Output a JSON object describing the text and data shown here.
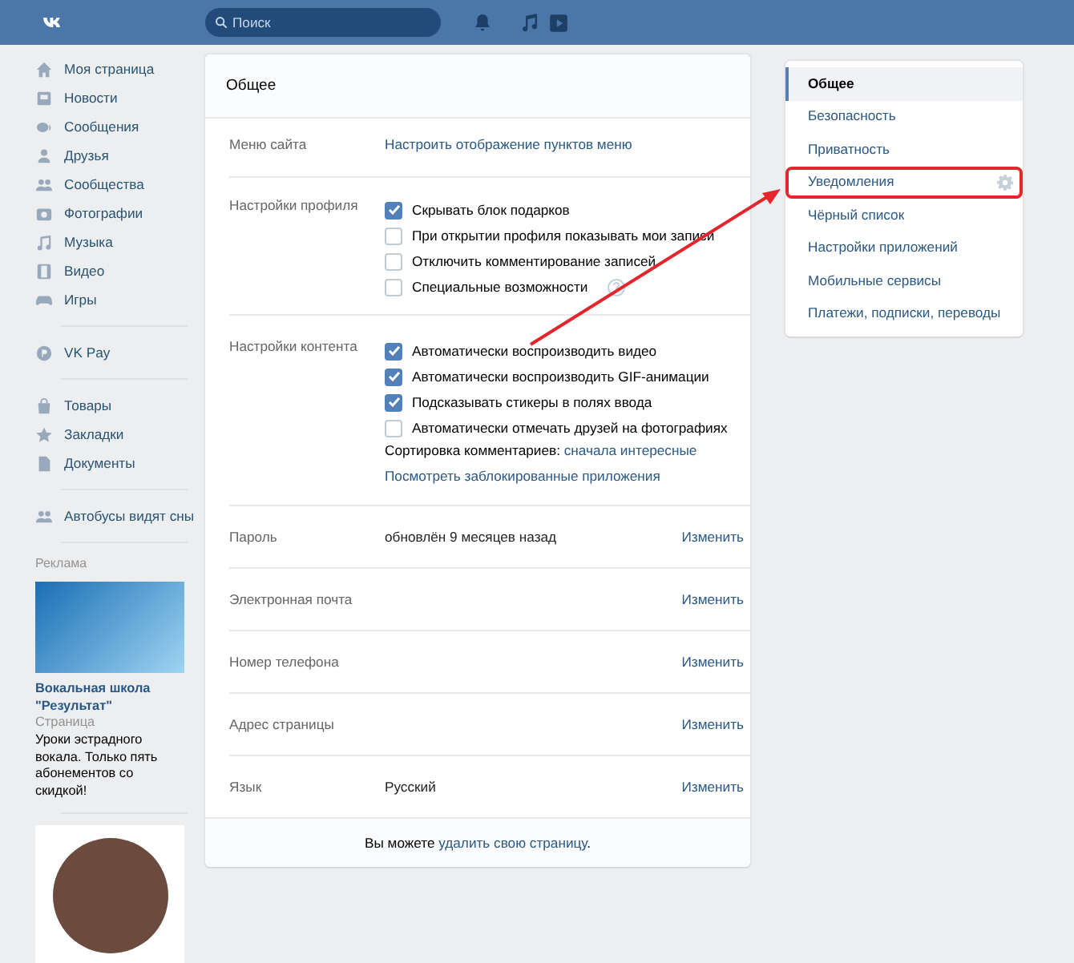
{
  "header": {
    "search": {
      "placeholder": "Поиск"
    }
  },
  "sidebar": {
    "groups": [
      [
        {
          "label": "Моя страница"
        },
        {
          "label": "Новости"
        },
        {
          "label": "Сообщения"
        },
        {
          "label": "Друзья"
        },
        {
          "label": "Сообщества"
        },
        {
          "label": "Фотографии"
        },
        {
          "label": "Музыка"
        },
        {
          "label": "Видео"
        },
        {
          "label": "Игры"
        }
      ],
      [
        {
          "label": "VK Pay"
        }
      ],
      [
        {
          "label": "Товары"
        },
        {
          "label": "Закладки"
        },
        {
          "label": "Документы"
        }
      ],
      [
        {
          "label": "Автобусы видят сны"
        }
      ]
    ]
  },
  "ads": {
    "label": "Реклама",
    "items": [
      {
        "title": "Вокальная школа \"Результат\"",
        "subtitle": "Страница",
        "text": "Уроки эстрадного вокала. Только пять абонементов со скидкой!"
      }
    ]
  },
  "settings": {
    "title": "Общее",
    "sections": [
      {
        "kind": "link",
        "label": "Меню сайта",
        "link": "Настроить отображение пунктов меню"
      },
      {
        "kind": "checks",
        "label": "Настройки профиля",
        "options": [
          {
            "label": "Скрывать блок подарков",
            "checked": true,
            "help": false
          },
          {
            "label": "При открытии профиля показывать мои записи",
            "checked": false,
            "help": false
          },
          {
            "label": "Отключить комментирование записей",
            "checked": false,
            "help": false
          },
          {
            "label": "Специальные возможности",
            "checked": false,
            "help": true
          }
        ]
      },
      {
        "kind": "checks",
        "label": "Настройки контента",
        "options": [
          {
            "label": "Автоматически воспроизводить видео",
            "checked": true,
            "help": false
          },
          {
            "label": "Автоматически воспроизводить GIF-анимации",
            "checked": true,
            "help": false
          },
          {
            "label": "Подсказывать стикеры в полях ввода",
            "checked": true,
            "help": false
          },
          {
            "label": "Автоматически отмечать друзей на фотографиях",
            "checked": false,
            "help": false
          }
        ],
        "sort": {
          "text": "Сортировка комментариев:",
          "link": "сначала интересные"
        },
        "link": "Посмотреть заблокированные приложения"
      },
      {
        "kind": "field",
        "label": "Пароль",
        "value": "обновлён 9 месяцев назад",
        "action": "Изменить"
      },
      {
        "kind": "field",
        "label": "Электронная почта",
        "action": "Изменить"
      },
      {
        "kind": "field",
        "label": "Номер телефона",
        "action": "Изменить"
      },
      {
        "kind": "field",
        "label": "Адрес страницы",
        "action": "Изменить"
      },
      {
        "kind": "field",
        "label": "Язык",
        "value": "Русский",
        "action": "Изменить"
      }
    ],
    "footer": {
      "before": "Вы можете",
      "link": "удалить свою страницу",
      "after": "."
    }
  },
  "menu": [
    {
      "label": "Общее",
      "selected": true,
      "highlighted": false
    },
    {
      "label": "Безопасность",
      "selected": false,
      "highlighted": false
    },
    {
      "label": "Приватность",
      "selected": false,
      "highlighted": false
    },
    {
      "label": "Уведомления",
      "selected": false,
      "highlighted": true
    },
    {
      "label": "Чёрный список",
      "selected": false,
      "highlighted": false
    },
    {
      "label": "Настройки приложений",
      "selected": false,
      "highlighted": false
    },
    {
      "label": "Мобильные сервисы",
      "selected": false,
      "highlighted": false
    },
    {
      "label": "Платежи, подписки, переводы",
      "selected": false,
      "highlighted": false
    }
  ]
}
